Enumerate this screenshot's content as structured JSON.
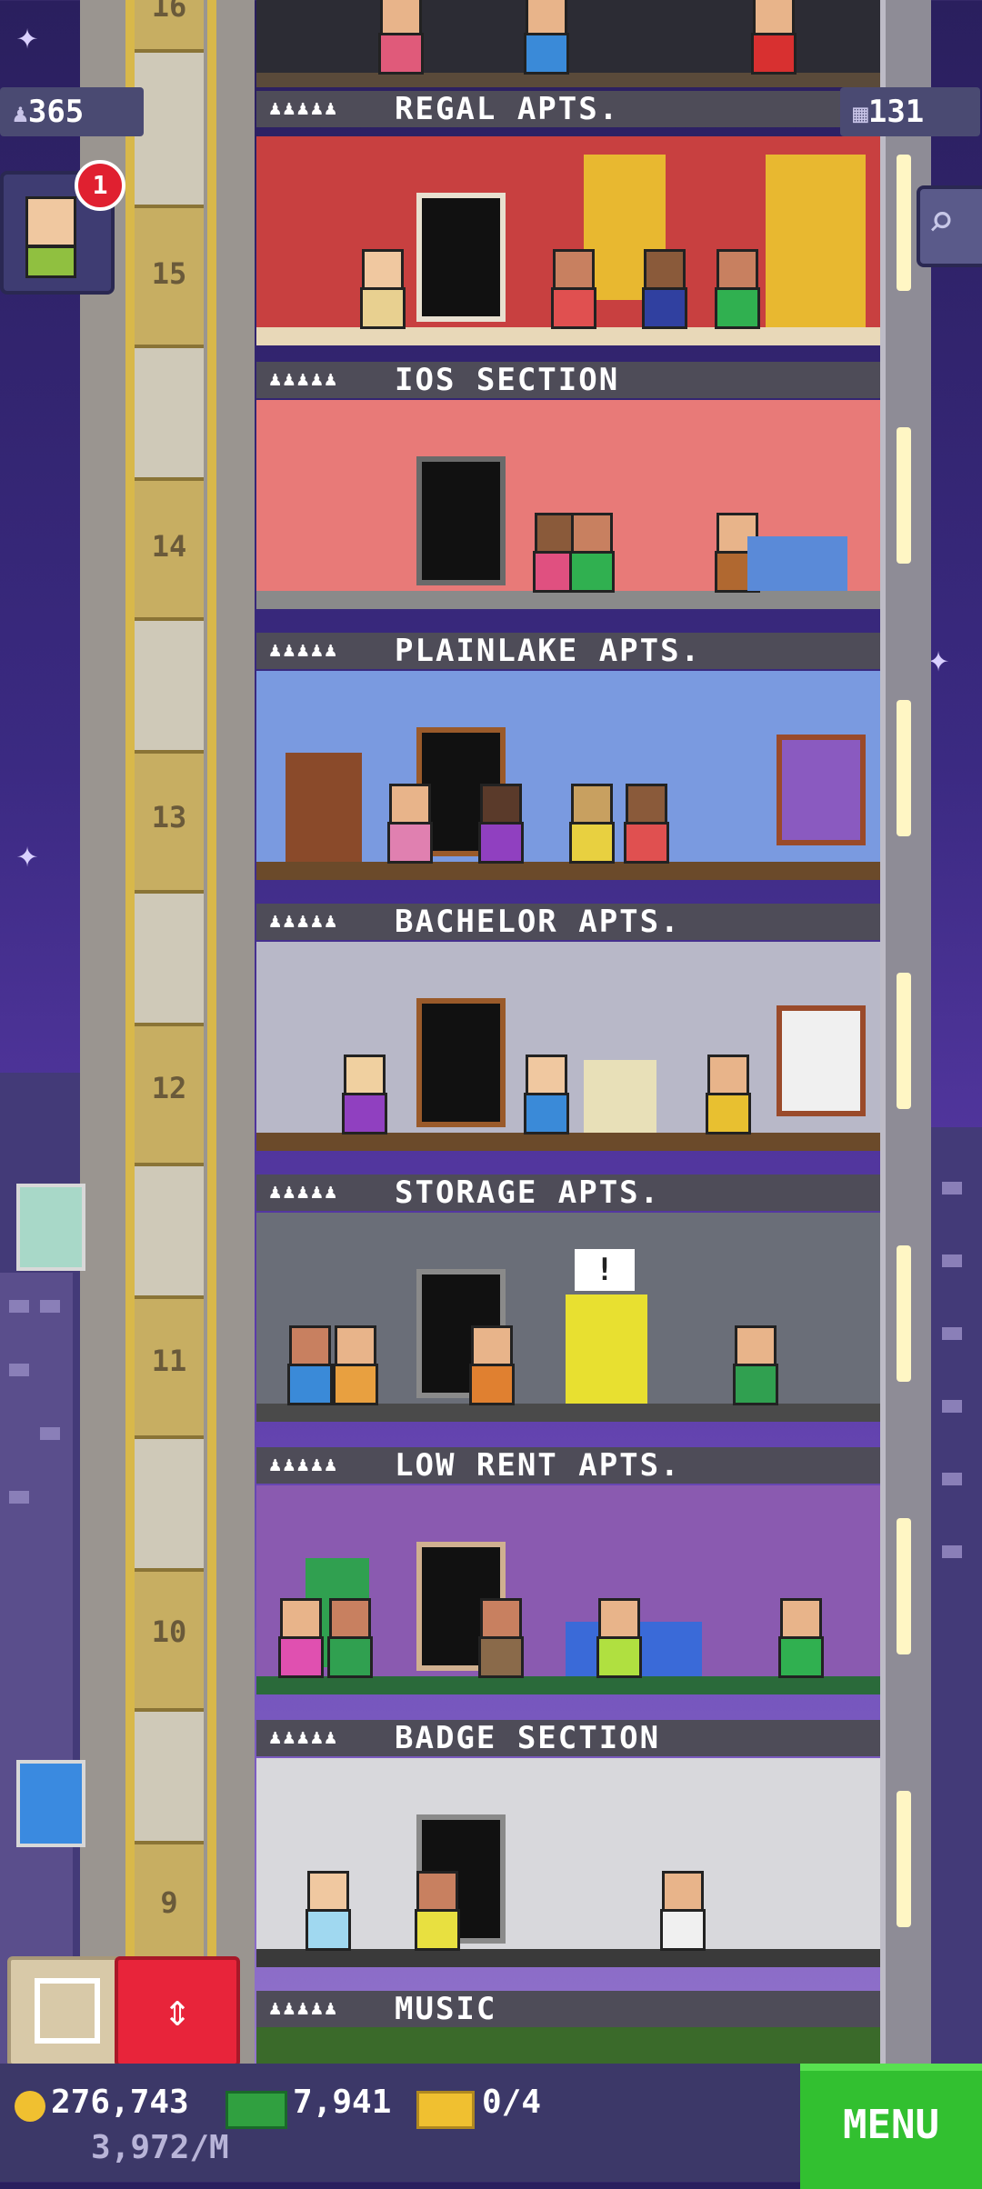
{
  "hud": {
    "population": "365",
    "floors_count": "131",
    "notification_count": "1",
    "coins": "276,743",
    "coins_rate": "3,972/M",
    "bux": "7,941",
    "tickets": "0/4",
    "menu_label": "MENU"
  },
  "tower": {
    "floor_numbers": [
      "16",
      "15",
      "14",
      "13",
      "12",
      "11",
      "10",
      "9"
    ],
    "floors": [
      {
        "label": "REGAL APTS."
      },
      {
        "label": "IOS SECTION"
      },
      {
        "label": "PLAINLAKE APTS."
      },
      {
        "label": "BACHELOR APTS."
      },
      {
        "label": "STORAGE APTS."
      },
      {
        "label": "LOW RENT APTS."
      },
      {
        "label": "BADGE SECTION"
      },
      {
        "label": "MUSIC"
      }
    ],
    "resident_dots": "♟♟♟♟♟"
  },
  "colors": {
    "sky": "#3b2a82",
    "hud_bar": "#3c3868",
    "menu_green": "#32c030",
    "elevator_red": "#e8243a"
  },
  "icons": [
    "population-icon",
    "floors-icon",
    "search-icon",
    "coin-icon",
    "bux-icon",
    "ticket-icon",
    "box-icon",
    "elevator-arrows-icon"
  ]
}
